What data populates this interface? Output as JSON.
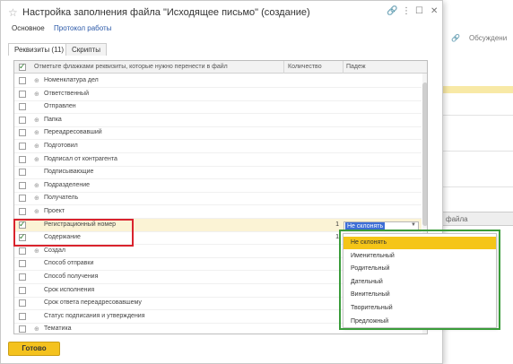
{
  "background": {
    "discussion_label": "Обсуждени",
    "column_header": "файла"
  },
  "dialog": {
    "title": "Настройка заполнения файла \"Исходящее письмо\" (создание)",
    "nav": {
      "main": "Основное",
      "protocol": "Протокол работы"
    },
    "tabs": [
      "Реквизиты (11)",
      "Скрипты"
    ],
    "table": {
      "headers": {
        "name": "Отметьте флажками реквизиты, которые нужно перенести в файл",
        "quantity": "Количество",
        "case": "Падеж"
      },
      "rows": [
        {
          "name": "Номенклатура дел",
          "expandable": true,
          "checked": false,
          "qty": ""
        },
        {
          "name": "Ответственный",
          "expandable": true,
          "checked": false,
          "qty": ""
        },
        {
          "name": "Отправлен",
          "expandable": false,
          "checked": false,
          "qty": ""
        },
        {
          "name": "Папка",
          "expandable": true,
          "checked": false,
          "qty": ""
        },
        {
          "name": "Переадресовавший",
          "expandable": true,
          "checked": false,
          "qty": ""
        },
        {
          "name": "Подготовил",
          "expandable": true,
          "checked": false,
          "qty": ""
        },
        {
          "name": "Подписал от контрагента",
          "expandable": true,
          "checked": false,
          "qty": ""
        },
        {
          "name": "Подписывающие",
          "expandable": false,
          "checked": false,
          "qty": ""
        },
        {
          "name": "Подразделение",
          "expandable": true,
          "checked": false,
          "qty": ""
        },
        {
          "name": "Получатель",
          "expandable": true,
          "checked": false,
          "qty": ""
        },
        {
          "name": "Проект",
          "expandable": true,
          "checked": false,
          "qty": ""
        },
        {
          "name": "Регистрационный номер",
          "expandable": false,
          "checked": true,
          "qty": "1",
          "selected": true
        },
        {
          "name": "Содержание",
          "expandable": false,
          "checked": true,
          "qty": "1"
        },
        {
          "name": "Создал",
          "expandable": true,
          "checked": false,
          "qty": ""
        },
        {
          "name": "Способ отправки",
          "expandable": false,
          "checked": false,
          "qty": ""
        },
        {
          "name": "Способ получения",
          "expandable": false,
          "checked": false,
          "qty": ""
        },
        {
          "name": "Срок исполнения",
          "expandable": false,
          "checked": false,
          "qty": ""
        },
        {
          "name": "Срок ответа переадресовавшему",
          "expandable": false,
          "checked": false,
          "qty": ""
        },
        {
          "name": "Статус подписания и утверждения",
          "expandable": false,
          "checked": false,
          "qty": ""
        },
        {
          "name": "Тематика",
          "expandable": true,
          "checked": false,
          "qty": ""
        }
      ]
    },
    "case_select": {
      "value": "Не склонять"
    },
    "case_options": [
      "Не склонять",
      "Именительный",
      "Родительный",
      "Дательный",
      "Винительный",
      "Творительный",
      "Предложный"
    ],
    "ok_button": "Готово"
  },
  "colors": {
    "accent_yellow": "#f4c21e",
    "selection_row": "#fbf3d5",
    "highlight_red": "#d9232d",
    "highlight_green": "#3a9c3a",
    "link": "#2a58a8"
  }
}
